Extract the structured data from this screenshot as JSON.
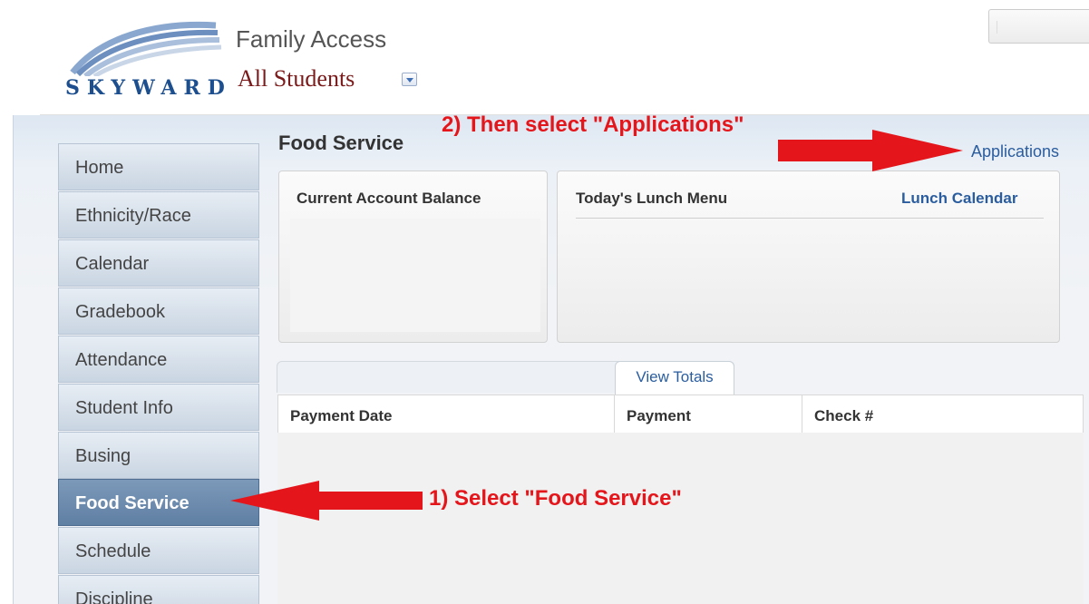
{
  "header": {
    "logo_text": "SKYWARD",
    "app_title": "Family Access",
    "student_selector": "All Students"
  },
  "sidebar": {
    "items": [
      {
        "label": "Home",
        "active": false
      },
      {
        "label": "Ethnicity/Race",
        "active": false
      },
      {
        "label": "Calendar",
        "active": false
      },
      {
        "label": "Gradebook",
        "active": false
      },
      {
        "label": "Attendance",
        "active": false
      },
      {
        "label": "Student Info",
        "active": false
      },
      {
        "label": "Busing",
        "active": false
      },
      {
        "label": "Food Service",
        "active": true
      },
      {
        "label": "Schedule",
        "active": false
      },
      {
        "label": "Discipline",
        "active": false
      }
    ]
  },
  "main": {
    "page_title": "Food Service",
    "applications_link": "Applications",
    "balance_panel": {
      "heading": "Current Account Balance"
    },
    "lunch_panel": {
      "heading": "Today's Lunch Menu",
      "calendar_link": "Lunch Calendar"
    },
    "tabs": {
      "view_totals": "View Totals"
    },
    "table": {
      "columns": [
        "Payment Date",
        "Payment",
        "Check #"
      ]
    }
  },
  "annotations": {
    "step_1": "1) Select \"Food Service\"",
    "step_2": "2) Then select \"Applications\"",
    "color": "#e5161b"
  }
}
